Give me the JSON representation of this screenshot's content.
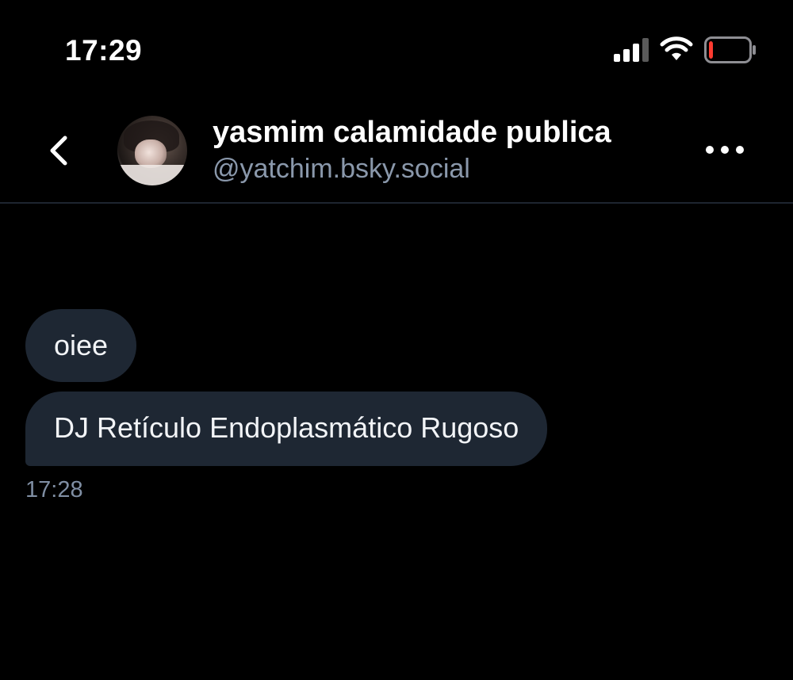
{
  "status_bar": {
    "time": "17:29",
    "icons": [
      "signal-icon",
      "wifi-icon",
      "battery-icon"
    ],
    "battery_level": 0.1,
    "battery_color": "#ff3b30"
  },
  "header": {
    "back_icon": "chevron-left-icon",
    "display_name": "yasmim calamidade publica",
    "handle": "@yatchim.bsky.social",
    "more_icon": "ellipsis-icon"
  },
  "messages": [
    {
      "text": "oiee"
    },
    {
      "text": "DJ Retículo Endoplasmático Rugoso"
    }
  ],
  "message_time": "17:28",
  "colors": {
    "background": "#000000",
    "bubble": "#1e2733",
    "secondary_text": "#8a98ab",
    "divider": "#1e2530"
  }
}
